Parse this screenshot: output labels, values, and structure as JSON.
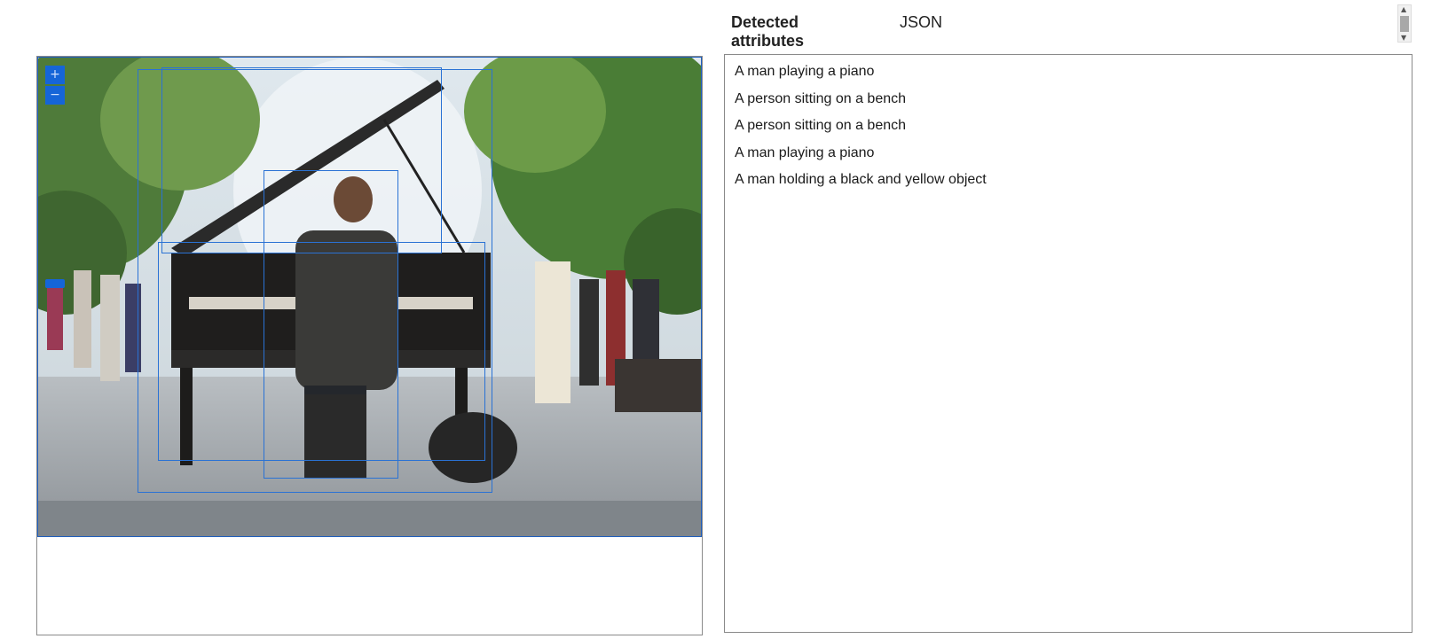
{
  "tabs": [
    {
      "label": "Detected attributes",
      "active": true
    },
    {
      "label": "JSON",
      "active": false
    }
  ],
  "viewer": {
    "zoom_in_label": "+",
    "zoom_out_label": "−"
  },
  "detected_attributes": [
    "A man playing a piano",
    "A person sitting on a bench",
    "A person sitting on a bench",
    "A man playing a piano",
    "A man holding a black and yellow object"
  ],
  "colors": {
    "accent": "#1565d8",
    "bbox": "#2a72d4"
  }
}
